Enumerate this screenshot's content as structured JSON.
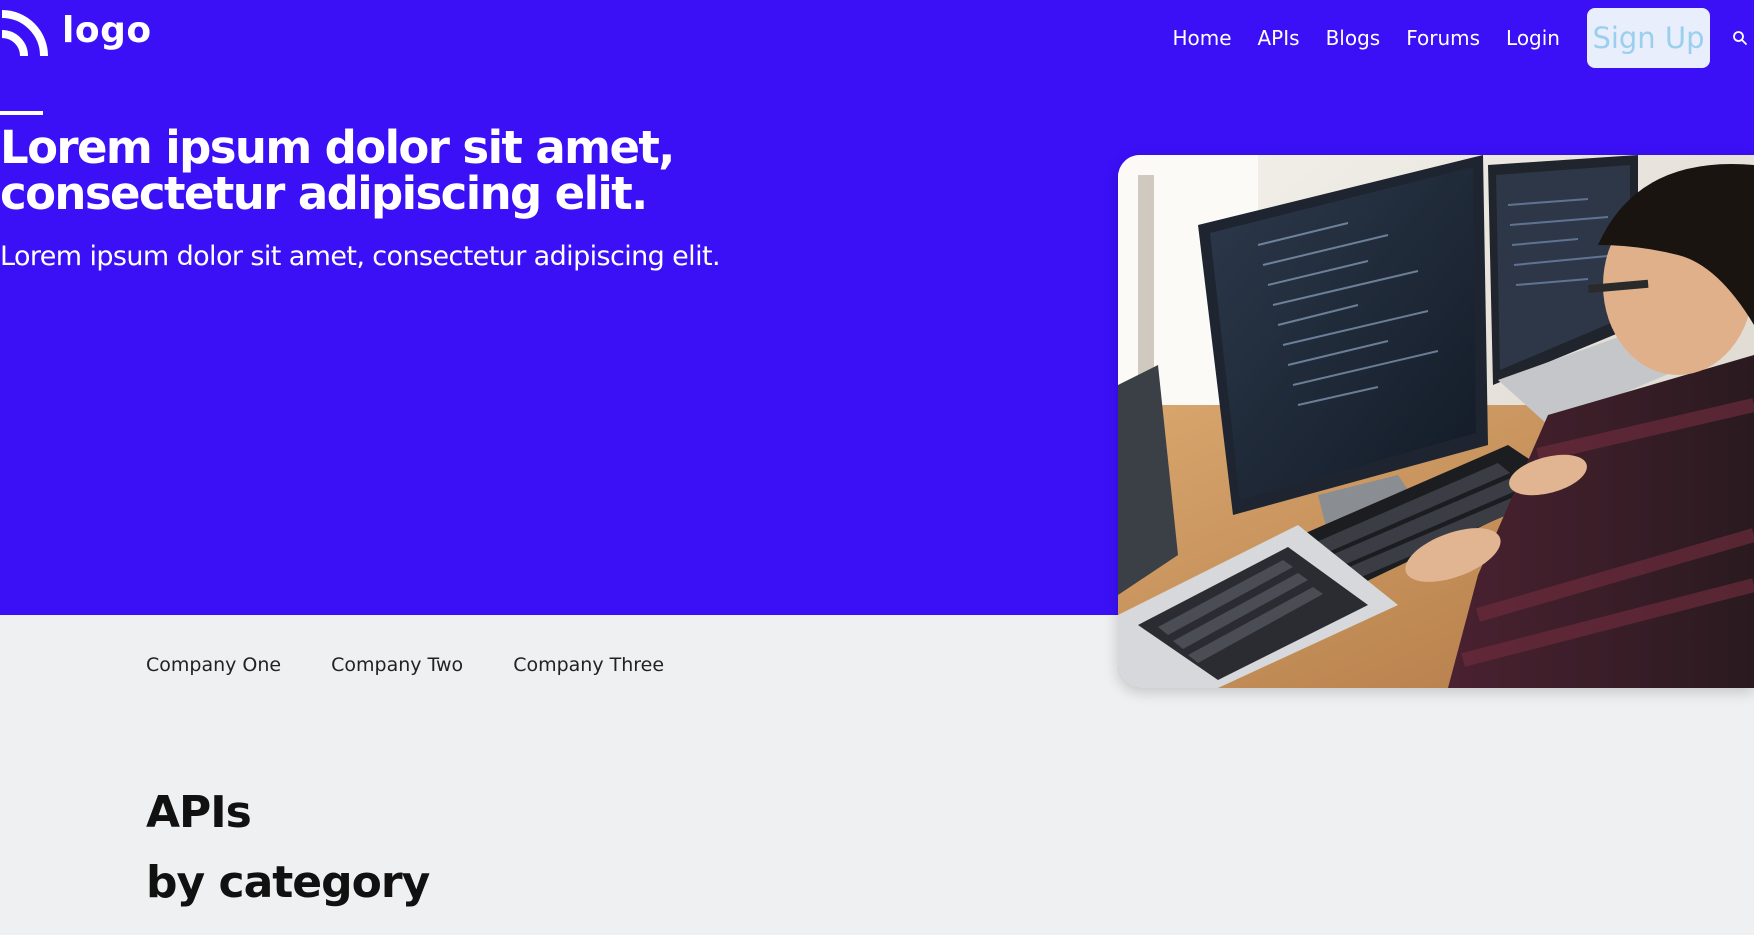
{
  "header": {
    "logo_text": "logo",
    "nav": {
      "items": [
        {
          "label": "Home"
        },
        {
          "label": "APIs"
        },
        {
          "label": "Blogs"
        },
        {
          "label": "Forums"
        },
        {
          "label": "Login"
        }
      ],
      "signup_label": "Sign Up",
      "search_icon": "search-icon"
    }
  },
  "hero": {
    "title": "Lorem ipsum dolor sit amet, consectetur adipiscing elit.",
    "subtitle": "Lorem ipsum dolor sit amet, consectetur adipiscing elit.",
    "image_icon": "developer-photo"
  },
  "companies": [
    {
      "name": "Company One"
    },
    {
      "name": "Company Two"
    },
    {
      "name": "Company Three"
    }
  ],
  "apis_section": {
    "heading_line1": "APIs",
    "heading_line2": "by category"
  },
  "colors": {
    "brand_blue": "#3b10f7",
    "page_bg": "#eef0f1",
    "signup_bg": "#e8eefb",
    "signup_text": "#9ad0ee"
  }
}
